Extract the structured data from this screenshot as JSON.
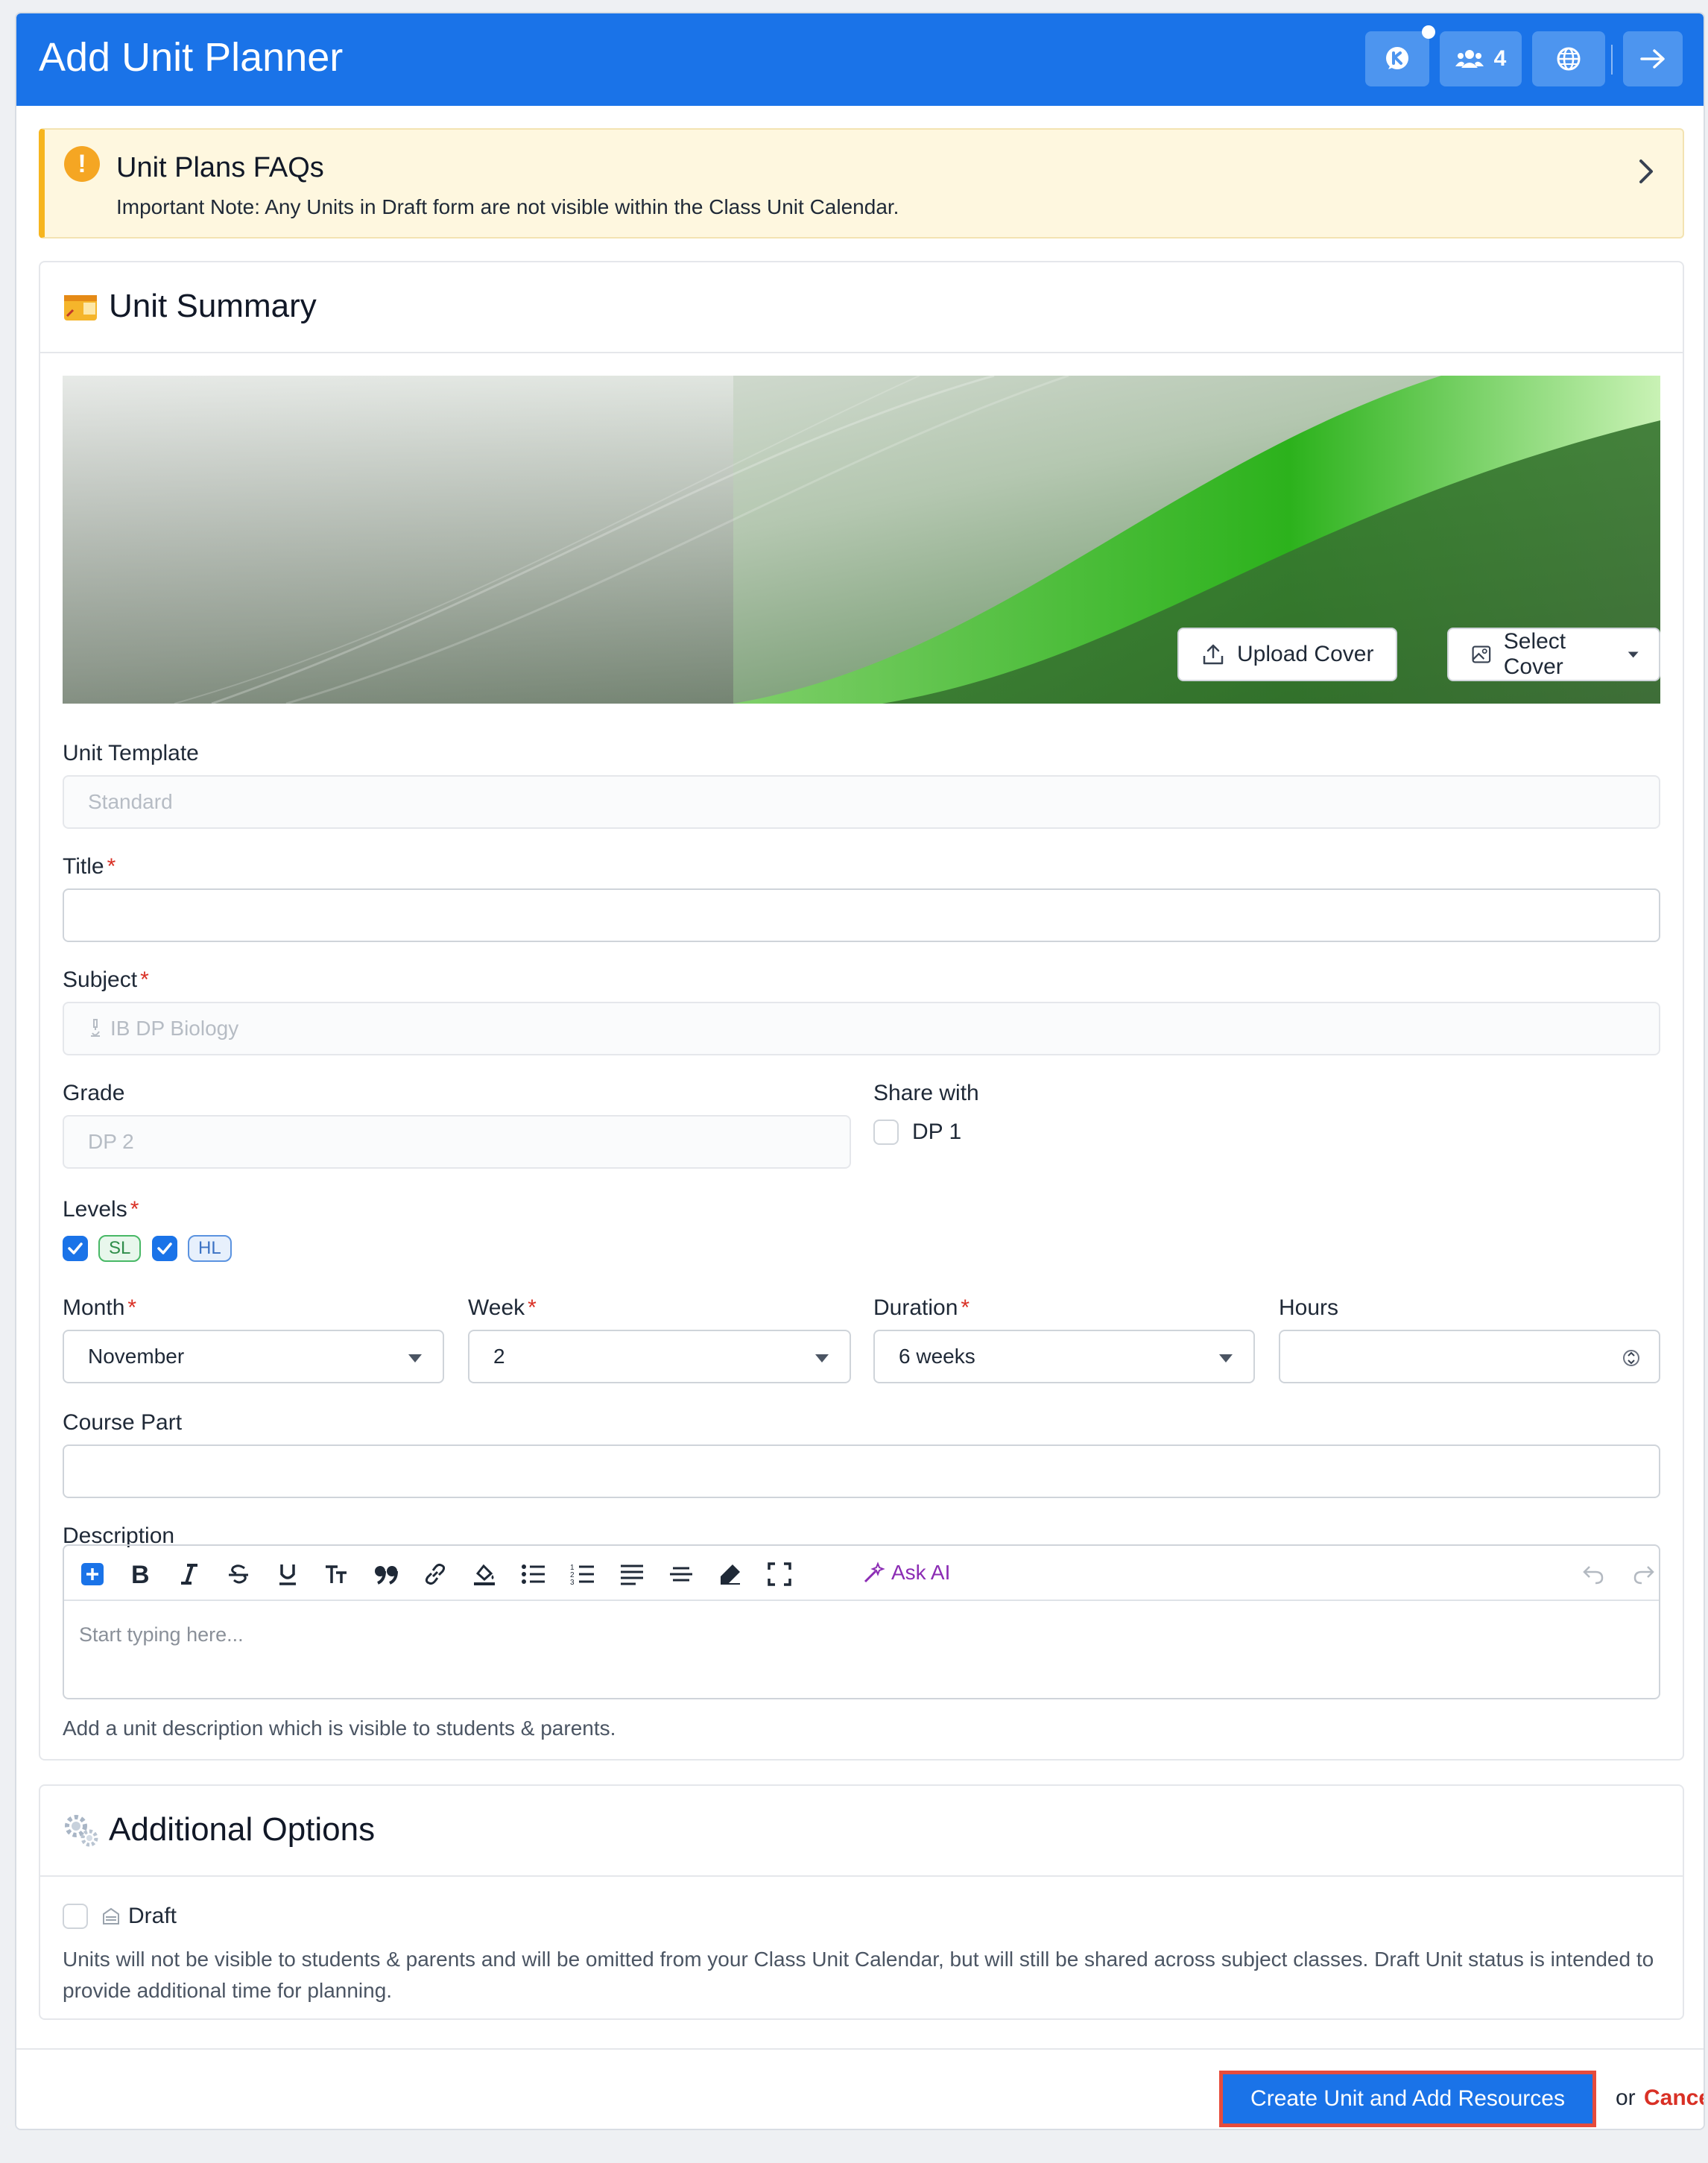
{
  "header": {
    "title": "Add Unit Planner",
    "members_count": "4"
  },
  "faq": {
    "title": "Unit Plans FAQs",
    "note": "Important Note: Any Units in Draft form are not visible within the Class Unit Calendar."
  },
  "summary": {
    "title": "Unit Summary",
    "upload_cover": "Upload Cover",
    "select_cover": "Select Cover",
    "unit_template_label": "Unit Template",
    "unit_template_value": "Standard",
    "title_label": "Title",
    "title_value": "",
    "subject_label": "Subject",
    "subject_value": "IB DP Biology",
    "grade_label": "Grade",
    "grade_value": "DP 2",
    "share_with_label": "Share with",
    "share_option": "DP 1",
    "levels_label": "Levels",
    "level_sl": "SL",
    "level_hl": "HL",
    "month_label": "Month",
    "month_value": "November",
    "week_label": "Week",
    "week_value": "2",
    "duration_label": "Duration",
    "duration_value": "6 weeks",
    "hours_label": "Hours",
    "hours_value": "",
    "course_part_label": "Course Part",
    "course_part_value": "",
    "description_label": "Description",
    "ask_ai": "Ask AI",
    "description_placeholder": "Start typing here...",
    "description_help": "Add a unit description which is visible to students & parents."
  },
  "additional": {
    "title": "Additional Options",
    "draft_label": "Draft",
    "draft_help": "Units will not be visible to students & parents and will be omitted from your Class Unit Calendar, but will still be shared across subject classes. Draft Unit status is intended to provide additional time for planning."
  },
  "footer": {
    "create_button": "Create Unit and Add Resources",
    "or_text": "or",
    "cancel": "Cancel"
  },
  "colors": {
    "brand": "#1a73e8",
    "required": "#d93025",
    "warning": "#f6b51e"
  }
}
